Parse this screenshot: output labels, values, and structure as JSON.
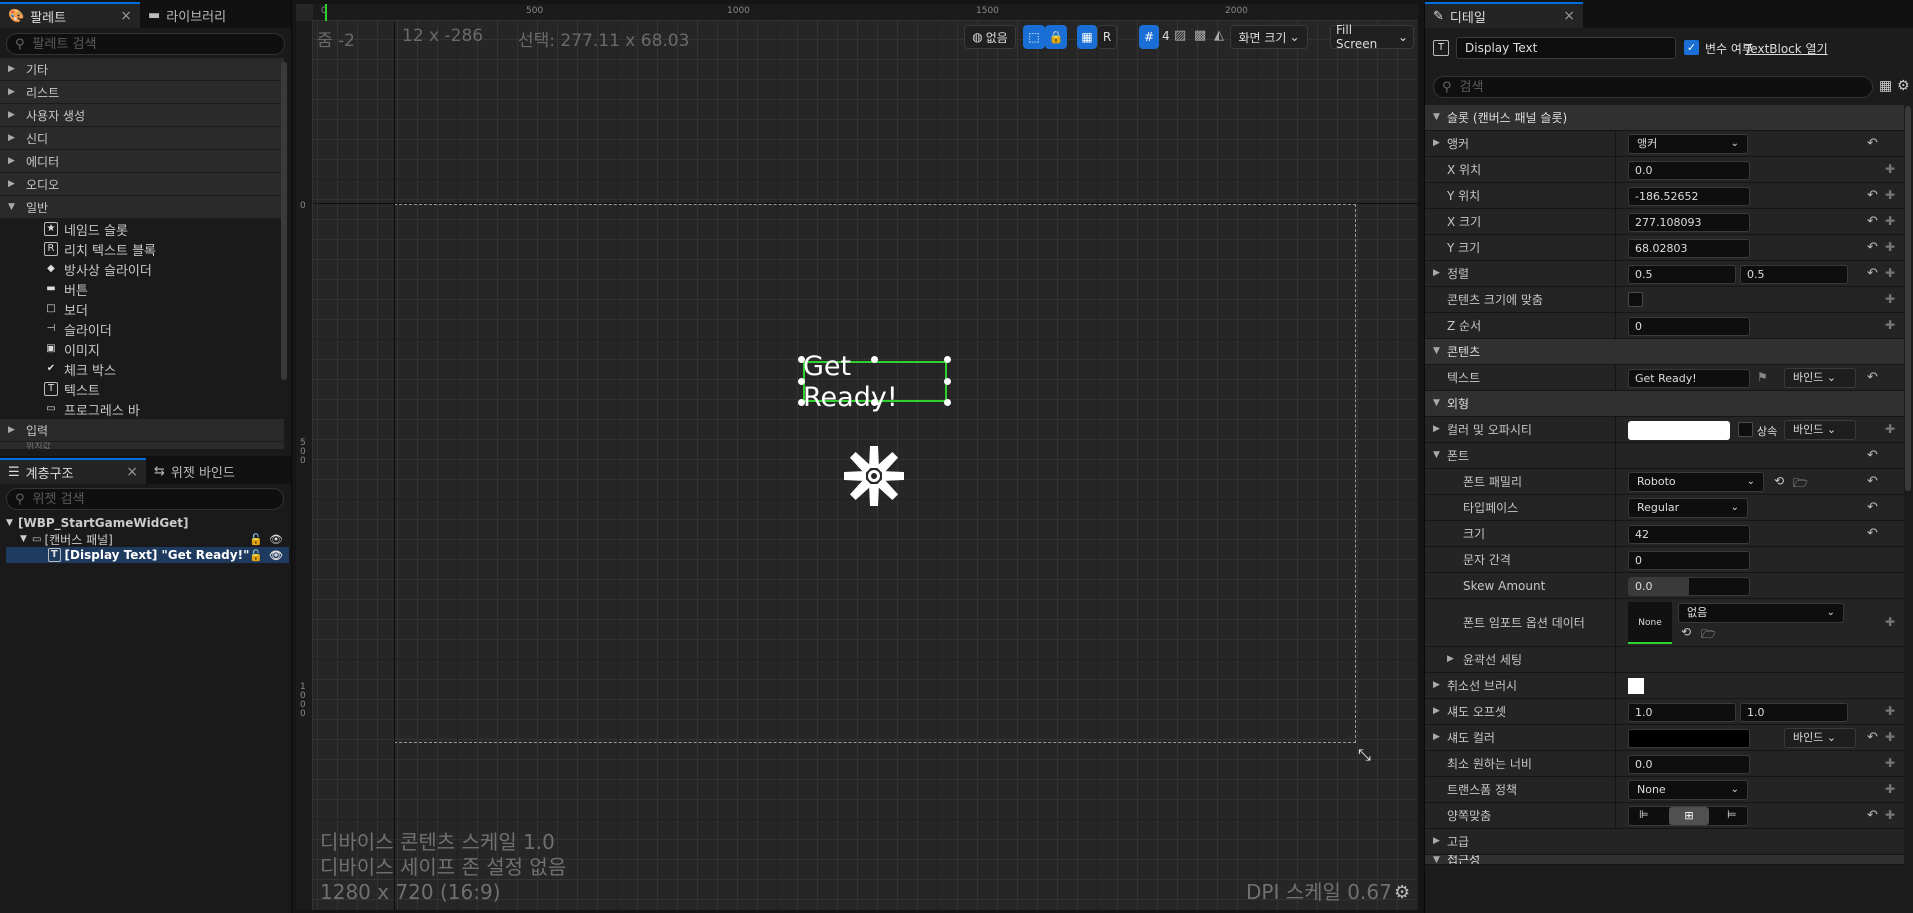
{
  "palette_tab": "팔레트",
  "library_tab": "라이브러리",
  "palette_search_placeholder": "팔레트 검색",
  "palette_categories": [
    "기타",
    "리스트",
    "사용자 생성",
    "신디",
    "에디터",
    "오디오",
    "일반"
  ],
  "palette_items": [
    {
      "icon": "★",
      "label": "네임드 슬롯"
    },
    {
      "icon": "R",
      "label": "리치 텍스트 블록"
    },
    {
      "icon": "◆",
      "label": "방사상 슬라이더"
    },
    {
      "icon": "▬",
      "label": "버튼"
    },
    {
      "icon": "□",
      "label": "보더"
    },
    {
      "icon": "⊣",
      "label": "슬라이더"
    },
    {
      "icon": "▣",
      "label": "이미지"
    },
    {
      "icon": "✔",
      "label": "체크 박스"
    },
    {
      "icon": "T",
      "label": "텍스트"
    },
    {
      "icon": "▭",
      "label": "프로그레스 바"
    }
  ],
  "palette_bottom_category": "입력",
  "palette_cut_label": "위치값",
  "hierarchy_tab": "계층구조",
  "bindings_tab": "위젯 바인드",
  "widget_search_placeholder": "위젯 검색",
  "hierarchy": {
    "root": "[WBP_StartGameWidGet]",
    "canvas": "[캔버스 패널]",
    "text": "[Display Text] \"Get Ready!\""
  },
  "viewport": {
    "zoom": "줌 -2",
    "coords": "12 x -286",
    "selection": "선택: 277.11 x 68.03",
    "none_label": "없음",
    "r_label": "R",
    "grid_num": "4",
    "screen_size_label": "화면 크기",
    "fill_screen_label": "Fill Screen",
    "ruler_top": [
      "0",
      "500",
      "1000",
      "1500",
      "2000"
    ],
    "ruler_left": [
      "0",
      "5\n0\n0",
      "1\n0\n0\n0"
    ],
    "widget_text": "Get Ready!",
    "info_line1": "디바이스 콘텐츠 스케일 1.0",
    "info_line2": "디바이스 세이프 존 설정 없음",
    "info_line3": "1280 x 720 (16:9)",
    "dpi": "DPI 스케일 0.67"
  },
  "details": {
    "tab": "디테일",
    "name": "Display Text",
    "is_variable_label": "변수 여부",
    "open_link": "TextBlock 열기",
    "search_placeholder": "검색",
    "slot_section": "슬롯 (캔버스 패널 슬롯)",
    "anchor_label": "앵커",
    "anchor_value": "앵커",
    "x_pos_label": "X 위치",
    "x_pos": "0.0",
    "y_pos_label": "Y 위치",
    "y_pos": "-186.52652",
    "x_size_label": "X 크기",
    "x_size": "277.108093",
    "y_size_label": "Y 크기",
    "y_size": "68.02803",
    "align_label": "정렬",
    "align_x": "0.5",
    "align_y": "0.5",
    "fit_label": "콘텐츠 크기에 맞춤",
    "z_label": "Z 순서",
    "z_value": "0",
    "content_section": "콘텐츠",
    "text_label": "텍스트",
    "text_value": "Get Ready!",
    "bind_label": "바인드",
    "appearance_section": "외형",
    "color_label": "컬러 및 오파시티",
    "inherit_label": "상속",
    "font_label": "폰트",
    "font_family_label": "폰트 패밀리",
    "font_family": "Roboto",
    "typeface_label": "타입페이스",
    "typeface": "Regular",
    "size_label": "크기",
    "size_value": "42",
    "letter_label": "문자 간격",
    "letter_value": "0",
    "skew_label": "Skew Amount",
    "skew_value": "0.0",
    "import_label": "폰트 임포트 옵션 데이터",
    "import_thumb": "None",
    "import_value": "없음",
    "outline_label": "윤곽선 세팅",
    "strike_label": "취소선 브러시",
    "shadow_offset_label": "섀도 오프셋",
    "shadow_x": "1.0",
    "shadow_y": "1.0",
    "shadow_color_label": "섀도 컬러",
    "min_width_label": "최소 원하는 너비",
    "min_width": "0.0",
    "transform_label": "트랜스폼 정책",
    "transform_value": "None",
    "justify_label": "양쪽맞춤",
    "advanced_label": "고급",
    "access_label": "접근성"
  },
  "colors": {
    "accent": "#1a6fd6",
    "selection_green": "#2fd12f",
    "white": "#ffffff"
  }
}
